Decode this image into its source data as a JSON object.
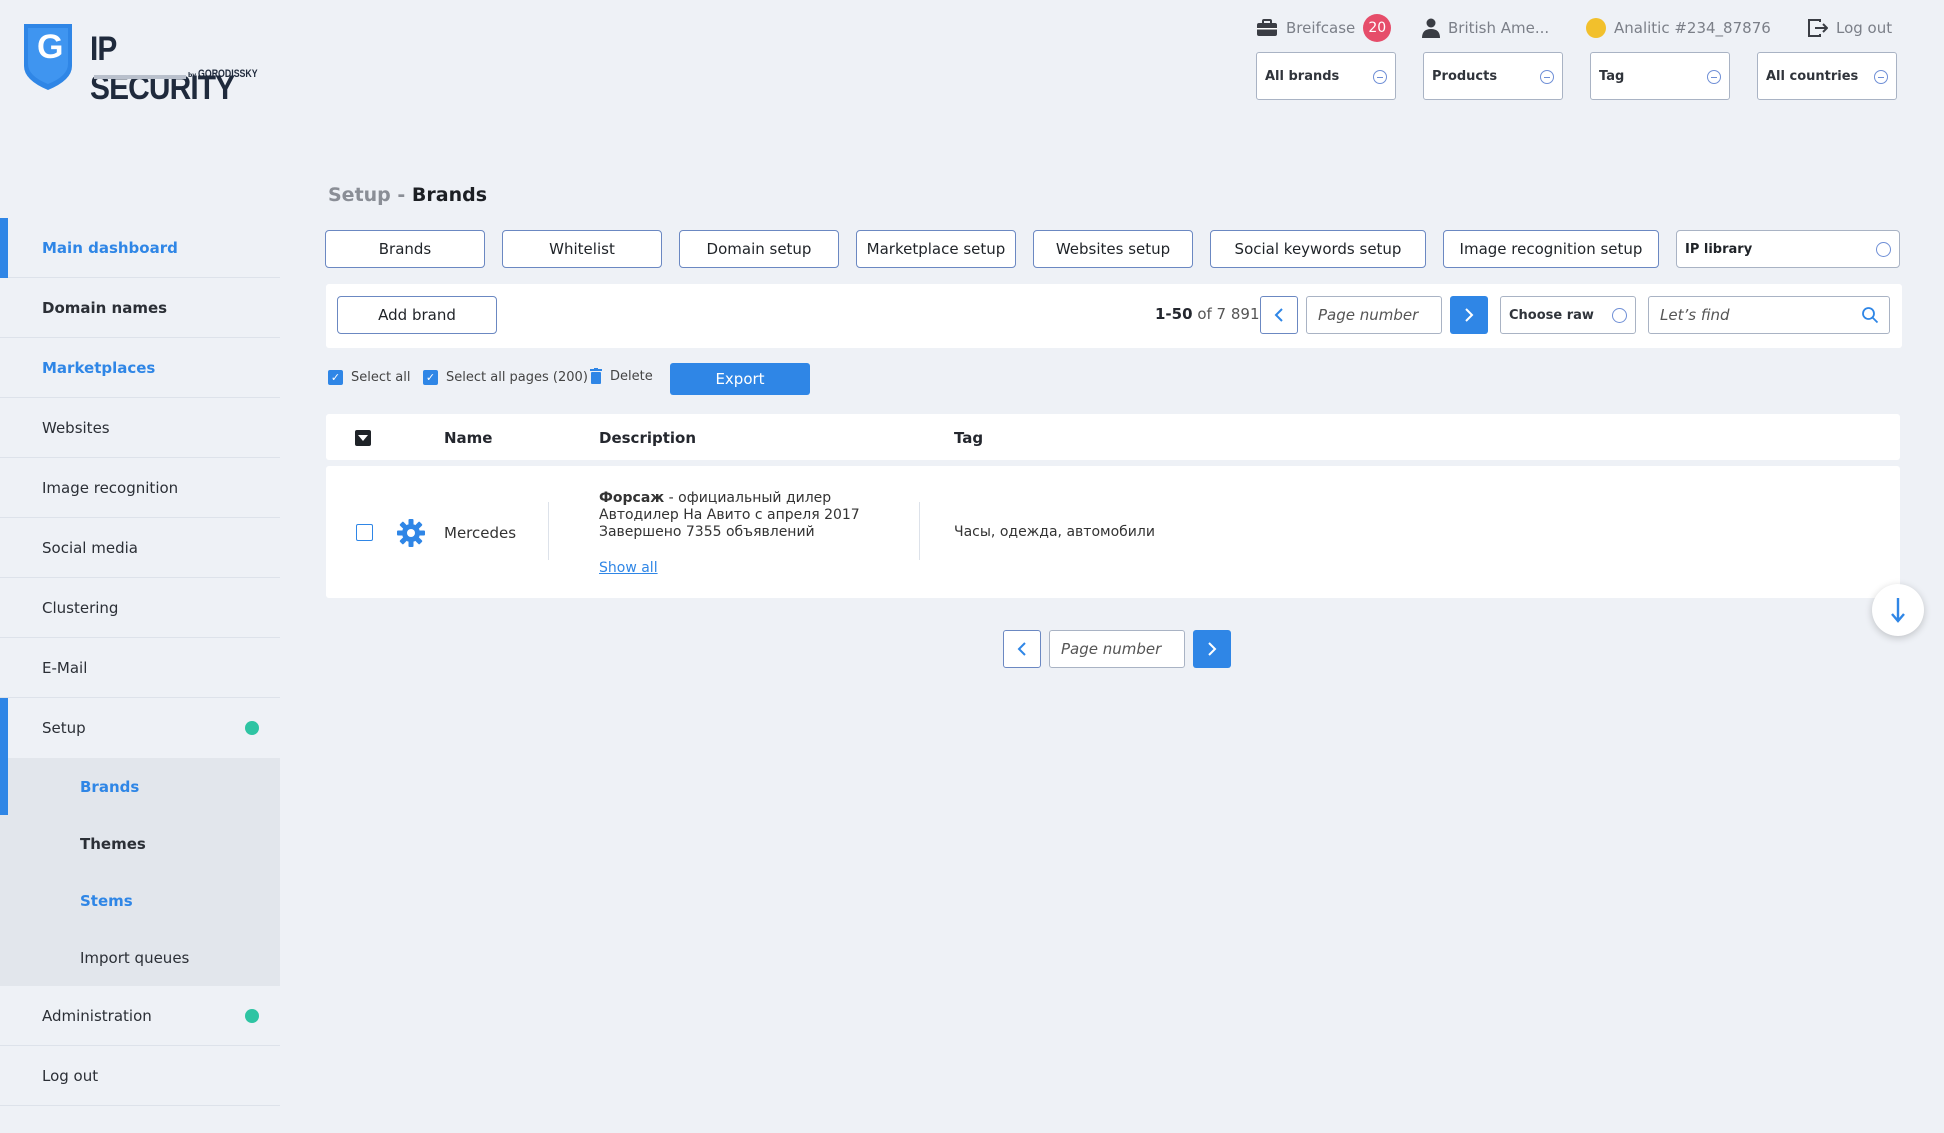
{
  "brand": {
    "title": "IP SECURITY",
    "by": "by",
    "sub": "GORODISSKY",
    "logo_letter": "G"
  },
  "topbar": {
    "briefcase_label": "Breifcase",
    "briefcase_count": "20",
    "user_label": "British Ame...",
    "analytic_label": "Analitic #234_87876",
    "logout_label": "Log out"
  },
  "filters": [
    "All brands",
    "Products",
    "Tag",
    "All countries"
  ],
  "sidebar": {
    "items": [
      {
        "label": "Main dashboard"
      },
      {
        "label": "Domain names"
      },
      {
        "label": "Marketplaces"
      },
      {
        "label": "Websites"
      },
      {
        "label": "Image recognition"
      },
      {
        "label": "Social media"
      },
      {
        "label": "Clustering"
      },
      {
        "label": "E-Mail"
      },
      {
        "label": "Setup"
      }
    ],
    "sub_items": [
      {
        "label": "Brands"
      },
      {
        "label": "Themes"
      },
      {
        "label": "Stems"
      },
      {
        "label": "Import queues"
      }
    ],
    "after": [
      {
        "label": "Administration"
      },
      {
        "label": "Log out"
      }
    ]
  },
  "breadcrumb": {
    "parent": "Setup - ",
    "current": "Brands"
  },
  "tabs": [
    "Brands",
    "Whitelist",
    "Domain setup",
    "Marketplace setup",
    "Websites setup",
    "Social keywords setup",
    "Image recognition setup"
  ],
  "tab_select": "IP library",
  "toolbar": {
    "add_label": "Add brand",
    "range": "1-50",
    "of_label": "of 7 891",
    "page_placeholder": "Page number",
    "choose_raw": "Choose raw",
    "search_placeholder": "Let’s find"
  },
  "actions": {
    "select_all": "Select all",
    "select_all_pages": "Select all pages (200)",
    "delete": "Delete",
    "export": "Export"
  },
  "table": {
    "headers": [
      "Name",
      "Description",
      "Tag"
    ],
    "rows": [
      {
        "name": "Mercedes",
        "desc_bold": "Форсаж",
        "desc_rest": " - официальный дилер",
        "desc_line2": "Автодилер На Авито с апреля 2017",
        "desc_line3": "Завершено 7355 объявлений",
        "show_all": "Show all",
        "tag": "Часы, одежда, автомобили"
      }
    ]
  },
  "pagination": {
    "page_placeholder": "Page number"
  },
  "colors": {
    "accent": "#2f86e6",
    "badge": "#e64d6a",
    "status_dot": "#2ec4a3",
    "analytic_dot": "#f2c02c"
  }
}
